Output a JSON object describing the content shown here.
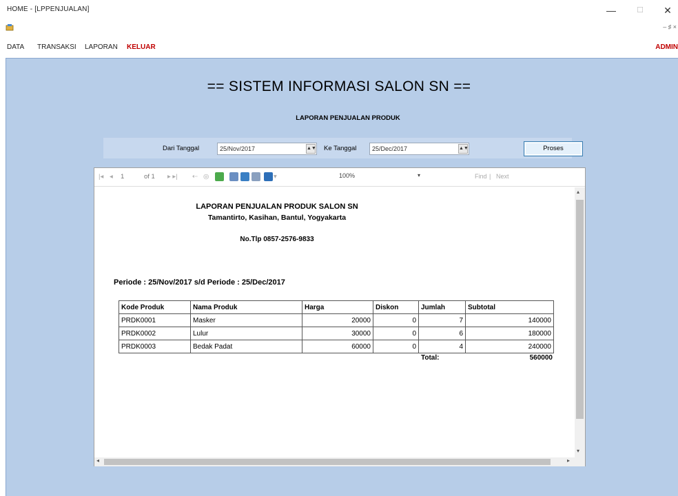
{
  "window": {
    "title": "HOME - [LPPENJUALAN]",
    "minimize": "—",
    "maximize": "☐",
    "close": "✕",
    "mdi_controls": "– ♯ ×"
  },
  "menu": {
    "items": [
      "DATA",
      "TRANSAKSI",
      "LAPORAN",
      "KELUAR"
    ],
    "user": "ADMIN"
  },
  "header": {
    "title": "== SISTEM INFORMASI SALON SN ==",
    "subtitle": "LAPORAN PENJUALAN PRODUK"
  },
  "filter": {
    "from_label": "Dari Tanggal",
    "from_value": "25/Nov/2017",
    "to_label": "Ke Tanggal",
    "to_value": "25/Dec/2017",
    "process_label": "Proses"
  },
  "viewer_toolbar": {
    "page_current": "1",
    "page_of": "of 1",
    "zoom": "100%",
    "find": "Find",
    "next": "Next"
  },
  "report": {
    "title": "LAPORAN PENJUALAN PRODUK SALON SN",
    "address": "Tamantirto, Kasihan, Bantul, Yogyakarta",
    "phone": "No.Tlp 0857-2576-9833",
    "periode": "Periode : 25/Nov/2017  s/d Periode : 25/Dec/2017",
    "columns": [
      "Kode Produk",
      "Nama Produk",
      "Harga",
      "Diskon",
      "Jumlah",
      "Subtotal"
    ],
    "rows": [
      [
        "PRDK0001",
        "Masker",
        "20000",
        "0",
        "7",
        "140000"
      ],
      [
        "PRDK0002",
        "Lulur",
        "30000",
        "0",
        "6",
        "180000"
      ],
      [
        "PRDK0003",
        "Bedak Padat",
        "60000",
        "0",
        "4",
        "240000"
      ]
    ],
    "total_label": "Total:",
    "total_value": "560000"
  },
  "colors": {
    "main_bg": "#b7cde8",
    "menu_red": "#c00000",
    "button_border": "#3c7fb1"
  }
}
